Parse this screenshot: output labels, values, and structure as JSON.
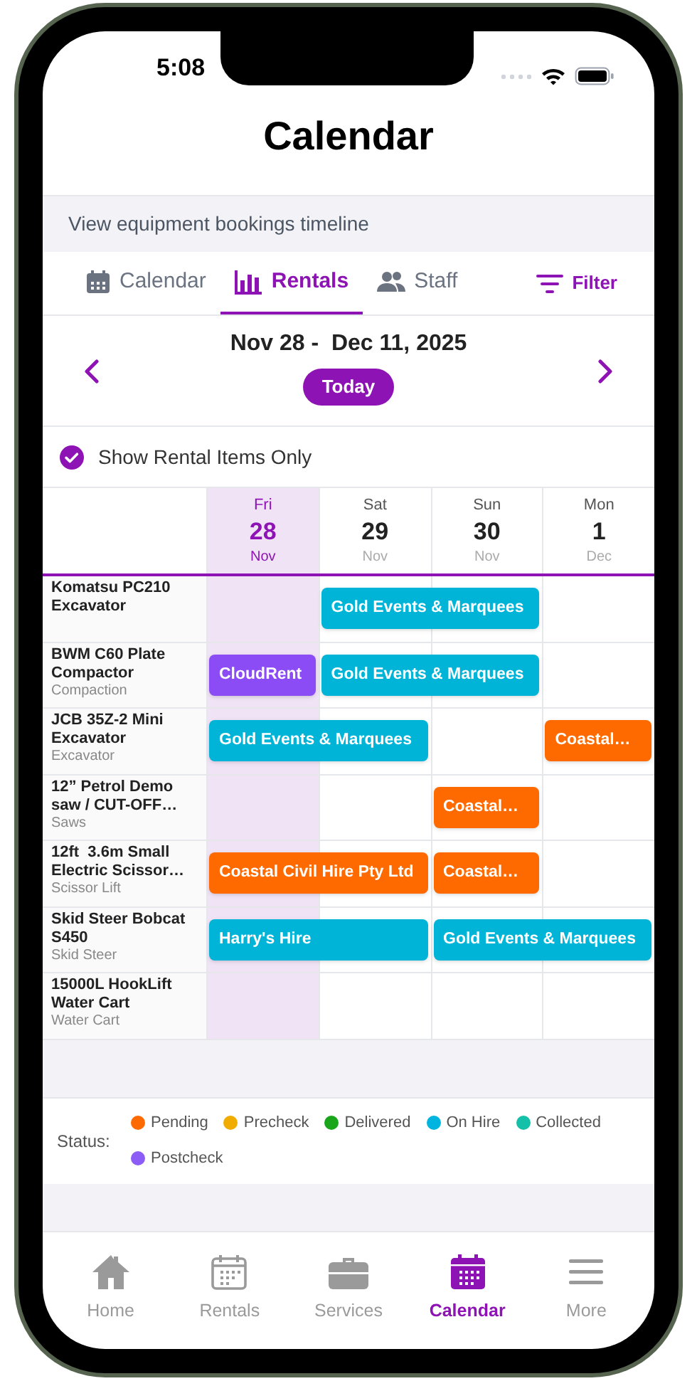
{
  "status_bar": {
    "time": "5:08"
  },
  "header": {
    "title": "Calendar",
    "subtitle": "View equipment bookings timeline"
  },
  "tabs": [
    {
      "label": "Calendar",
      "selected": false
    },
    {
      "label": "Rentals",
      "selected": true
    },
    {
      "label": "Staff",
      "selected": false
    }
  ],
  "filter_button": {
    "label": "Filter"
  },
  "date_nav": {
    "range": "Nov 28 -  Dec 11, 2025",
    "today_button": "Today"
  },
  "rental_only_toggle": {
    "label": "Show Rental Items Only",
    "checked": true
  },
  "days": [
    {
      "weekday": "Fri",
      "day": "28",
      "month": "Nov",
      "selected": true
    },
    {
      "weekday": "Sat",
      "day": "29",
      "month": "Nov",
      "selected": false
    },
    {
      "weekday": "Sun",
      "day": "30",
      "month": "Nov",
      "selected": false
    },
    {
      "weekday": "Mon",
      "day": "1",
      "month": "Dec",
      "selected": false
    }
  ],
  "rows": [
    {
      "name": "Komatsu PC210 Excavator",
      "slots": [
        {
          "kind": "empty"
        },
        {
          "kind": "booking",
          "label": "Gold Events & Marquees",
          "color": "#00b4d8"
        },
        {
          "kind": "continued"
        },
        {
          "kind": "empty"
        }
      ]
    },
    {
      "name": "BWM C60 Plate Compactor",
      "category": "Compaction",
      "slots": [
        {
          "kind": "booking",
          "label": "CloudRent",
          "color": "#8b4cf6"
        },
        {
          "kind": "booking",
          "label": "Gold Events & Marquees",
          "color": "#00b4d8"
        },
        {
          "kind": "continued"
        },
        {
          "kind": "empty"
        }
      ]
    },
    {
      "name": "JCB 35Z-2 Mini Excavator",
      "category": "Excavator",
      "slots": [
        {
          "kind": "booking",
          "label": "Gold Events & Marquees",
          "color": "#00b4d8"
        },
        {
          "kind": "continued"
        },
        {
          "kind": "empty"
        },
        {
          "kind": "booking",
          "label": "Coastal…",
          "color": "#ff6a00"
        }
      ]
    },
    {
      "name": "12” Petrol Demo saw / CUT-OFF…",
      "category": "Saws",
      "slots": [
        {
          "kind": "empty"
        },
        {
          "kind": "empty"
        },
        {
          "kind": "booking",
          "label": "Coastal…",
          "color": "#ff6a00"
        },
        {
          "kind": "empty"
        }
      ]
    },
    {
      "name": "12ft  3.6m Small Electric Scissor…",
      "category": "Scissor Lift",
      "slots": [
        {
          "kind": "booking",
          "label": "Coastal Civil Hire Pty Ltd",
          "color": "#ff6a00"
        },
        {
          "kind": "continued"
        },
        {
          "kind": "booking",
          "label": "Coastal…",
          "color": "#ff6a00"
        },
        {
          "kind": "empty"
        }
      ]
    },
    {
      "name": "Skid Steer Bobcat S450",
      "category": "Skid Steer",
      "slots": [
        {
          "kind": "booking",
          "label": "Harry's Hire",
          "color": "#00b4d8"
        },
        {
          "kind": "continued"
        },
        {
          "kind": "booking",
          "label": "Gold Events & Marquees",
          "color": "#00b4d8"
        },
        {
          "kind": "continued"
        }
      ]
    },
    {
      "name": "15000L HookLift Water Cart",
      "category": "Water Cart",
      "slots": [
        {
          "kind": "empty"
        },
        {
          "kind": "empty"
        },
        {
          "kind": "empty"
        },
        {
          "kind": "empty"
        }
      ]
    }
  ],
  "legend": {
    "label": "Status:",
    "items": [
      {
        "label": "Pending",
        "color": "#ff6a00"
      },
      {
        "label": "Precheck",
        "color": "#f0ad00"
      },
      {
        "label": "Delivered",
        "color": "#1aa61a"
      },
      {
        "label": "On Hire",
        "color": "#00b4e0"
      },
      {
        "label": "Collected",
        "color": "#14c0a8"
      },
      {
        "label": "Postcheck",
        "color": "#8b5cf6"
      }
    ]
  },
  "bottom_nav": [
    {
      "label": "Home",
      "selected": false
    },
    {
      "label": "Rentals",
      "selected": false
    },
    {
      "label": "Services",
      "selected": false
    },
    {
      "label": "Calendar",
      "selected": true
    },
    {
      "label": "More",
      "selected": false
    }
  ]
}
